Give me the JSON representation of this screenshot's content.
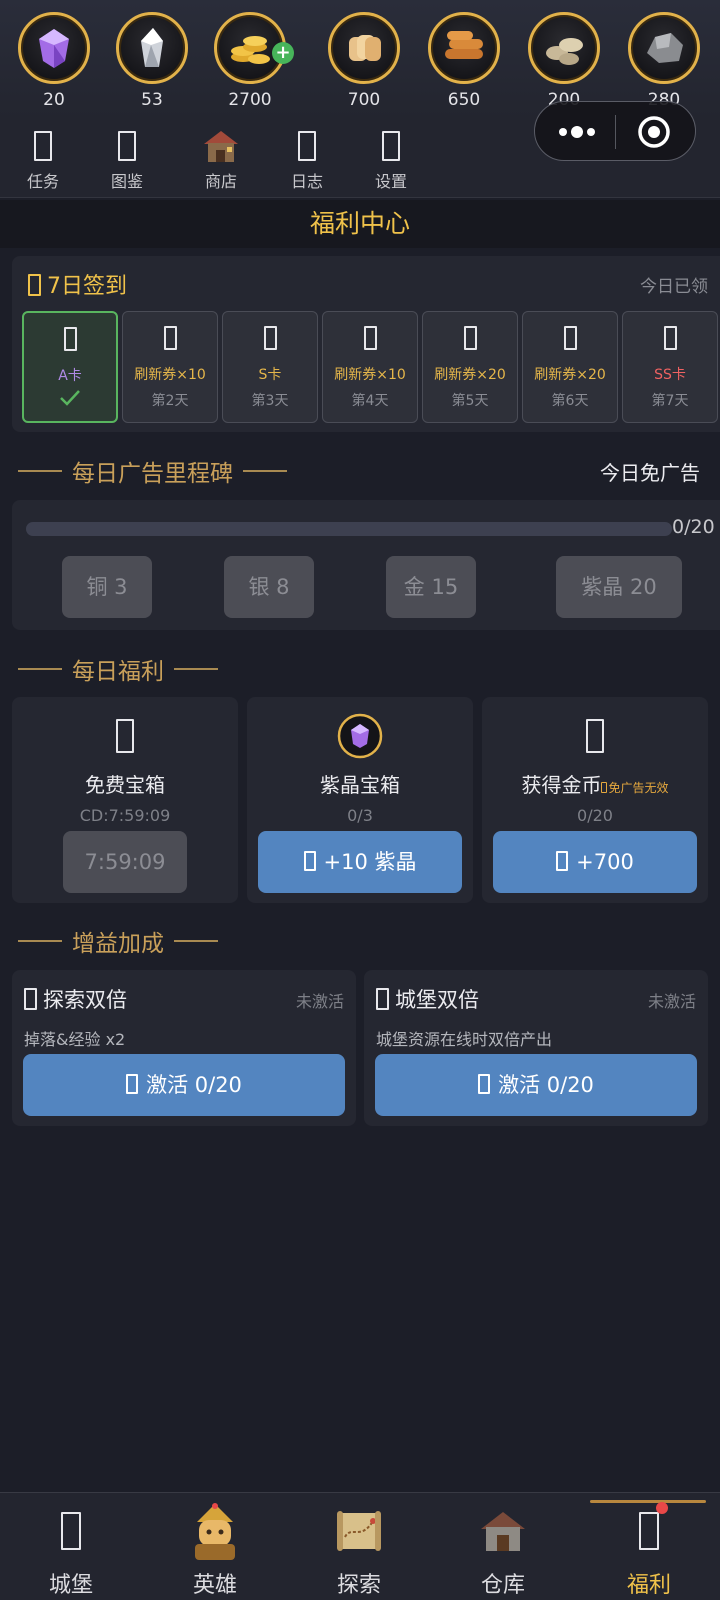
{
  "resources": [
    {
      "icon": "purple-gem-icon",
      "value": "20"
    },
    {
      "icon": "crystal-icon",
      "value": "53"
    },
    {
      "icon": "gold-coins-icon",
      "value": "2700"
    },
    {
      "icon": "bread-icon",
      "value": "700"
    },
    {
      "icon": "wood-logs-icon",
      "value": "650"
    },
    {
      "icon": "stone-icon",
      "value": "200"
    },
    {
      "icon": "iron-ore-icon",
      "value": "280"
    }
  ],
  "top_nav": [
    {
      "icon": "task-icon",
      "label": "任务"
    },
    {
      "icon": "codex-icon",
      "label": "图鉴"
    },
    {
      "icon": "shop-icon",
      "label": "商店"
    },
    {
      "icon": "log-icon",
      "label": "日志"
    },
    {
      "icon": "settings-icon",
      "label": "设置"
    }
  ],
  "page_title": "福利中心",
  "signin": {
    "title": "7日签到",
    "status": "今日已领",
    "days": [
      {
        "reward": "A卡",
        "label": "",
        "claimed": true
      },
      {
        "reward": "刷新券×10",
        "label": "第2天"
      },
      {
        "reward": "S卡",
        "label": "第3天"
      },
      {
        "reward": "刷新券×10",
        "label": "第4天"
      },
      {
        "reward": "刷新券×20",
        "label": "第5天"
      },
      {
        "reward": "刷新券×20",
        "label": "第6天"
      },
      {
        "reward": "SS卡",
        "label": "第7天"
      }
    ]
  },
  "ad_milestone": {
    "title": "每日广告里程碑",
    "free_ad_label": "今日免广告",
    "progress_text": "0/20",
    "progress": 0,
    "tiers": [
      "铜 3",
      "银 8",
      "金 15",
      "紫晶 20"
    ]
  },
  "daily": {
    "title": "每日福利",
    "cards": [
      {
        "name": "免费宝箱",
        "tag": "",
        "sub": "CD:7:59:09",
        "button": "7:59:09"
      },
      {
        "name": "紫晶宝箱",
        "tag": "",
        "sub": "0/3",
        "button": "+10 紫晶"
      },
      {
        "name": "获得金币",
        "tag": "免广告无效",
        "sub": "0/20",
        "button": "+700"
      }
    ]
  },
  "buffs": {
    "title": "增益加成",
    "items": [
      {
        "name": "探索双倍",
        "status": "未激活",
        "desc": "掉落&经验 x2",
        "button": "激活 0/20"
      },
      {
        "name": "城堡双倍",
        "status": "未激活",
        "desc": "城堡资源在线时双倍产出",
        "button": "激活 0/20"
      }
    ]
  },
  "tabs": [
    {
      "icon": "castle-icon",
      "label": "城堡"
    },
    {
      "icon": "hero-icon",
      "label": "英雄"
    },
    {
      "icon": "explore-map-icon",
      "label": "探索"
    },
    {
      "icon": "warehouse-icon",
      "label": "仓库"
    },
    {
      "icon": "welfare-icon",
      "label": "福利",
      "active": true
    }
  ],
  "colors": {
    "accent": "#f0c24a",
    "button_blue": "#5385c0",
    "claimed_green": "#59b55f"
  }
}
